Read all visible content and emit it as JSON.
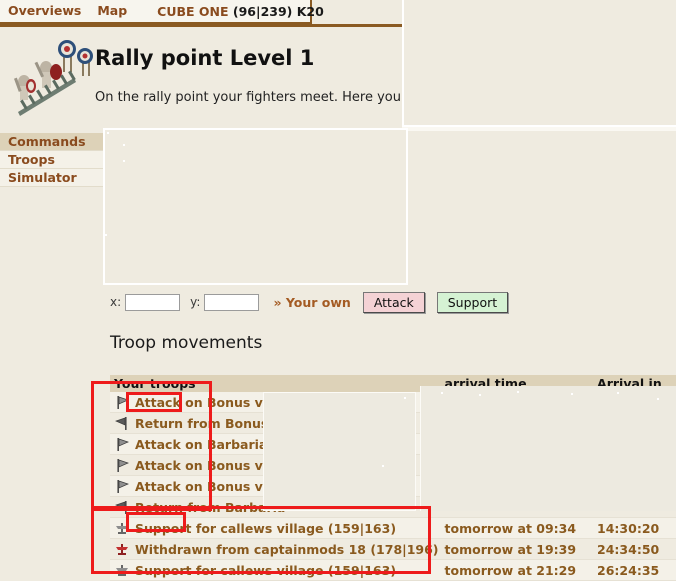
{
  "topnav": {
    "items": [
      {
        "label": "Overviews",
        "name": "nav-overviews"
      },
      {
        "label": "Map",
        "name": "nav-map"
      }
    ],
    "village_name": "CUBE ONE",
    "village_coords": "(96|239) K20"
  },
  "header": {
    "title": "Rally point Level 1",
    "description": "On the rally point your fighters meet. Here you c",
    "art_icon": "rally-point-troops-icon"
  },
  "sidebar": {
    "items": [
      {
        "label": "Commands",
        "name": "sidebar-item-commands",
        "active": true
      },
      {
        "label": "Troops",
        "name": "sidebar-item-troops",
        "active": false
      },
      {
        "label": "Simulator",
        "name": "sidebar-item-simulator",
        "active": false
      }
    ]
  },
  "coord_form": {
    "x_label": "x:",
    "y_label": "y:",
    "x_value": "",
    "y_value": "",
    "x_placeholder": "",
    "y_placeholder": "",
    "your_own_label": "» Your own",
    "attack_button": "Attack",
    "support_button": "Support",
    "attack_color": "#f4d2d5",
    "support_color": "#d5f2d3"
  },
  "troop_movements": {
    "title": "Troop movements",
    "columns": {
      "troops": "Your troops",
      "arrival_time": "arrival time",
      "arrival_in": "Arrival in"
    },
    "rows": [
      {
        "icon": "attack-flag-icon",
        "label": "Attack on Bonus villag",
        "arrival_time": "",
        "arrival_in": ""
      },
      {
        "icon": "return-flag-icon",
        "label": "Return from Bonus vil",
        "arrival_time": "",
        "arrival_in": ""
      },
      {
        "icon": "attack-flag-icon",
        "label": "Attack on Barbarian v",
        "arrival_time": "",
        "arrival_in": ""
      },
      {
        "icon": "attack-flag-icon",
        "label": "Attack on Bonus villag",
        "arrival_time": "",
        "arrival_in": ""
      },
      {
        "icon": "attack-flag-icon",
        "label": "Attack on Bonus villag",
        "arrival_time": "",
        "arrival_in": ""
      },
      {
        "icon": "return-flag-icon",
        "label": "Return from Barbaria",
        "arrival_time": "",
        "arrival_in": ""
      },
      {
        "icon": "support-shield-icon",
        "label": "Support for callews village (159|163)",
        "arrival_time": "tomorrow at 09:34",
        "arrival_in": "14:30:20"
      },
      {
        "icon": "withdraw-shield-icon",
        "label": "Withdrawn from captainmods 18 (178|196)",
        "arrival_time": "tomorrow at 19:39",
        "arrival_in": "24:34:50"
      },
      {
        "icon": "support-shield-icon",
        "label": "Support for callews village (159|163)",
        "arrival_time": "tomorrow at 21:29",
        "arrival_in": "26:24:35"
      }
    ]
  },
  "annotations": {
    "color": "#ee1b1b",
    "boxes": [
      {
        "name": "annotation-attack-keyword",
        "target": "Attack"
      },
      {
        "name": "annotation-attack-column",
        "target": "attack movement rows"
      },
      {
        "name": "annotation-support-keyword",
        "target": "Support"
      },
      {
        "name": "annotation-support-rows",
        "target": "support movement rows"
      }
    ]
  }
}
